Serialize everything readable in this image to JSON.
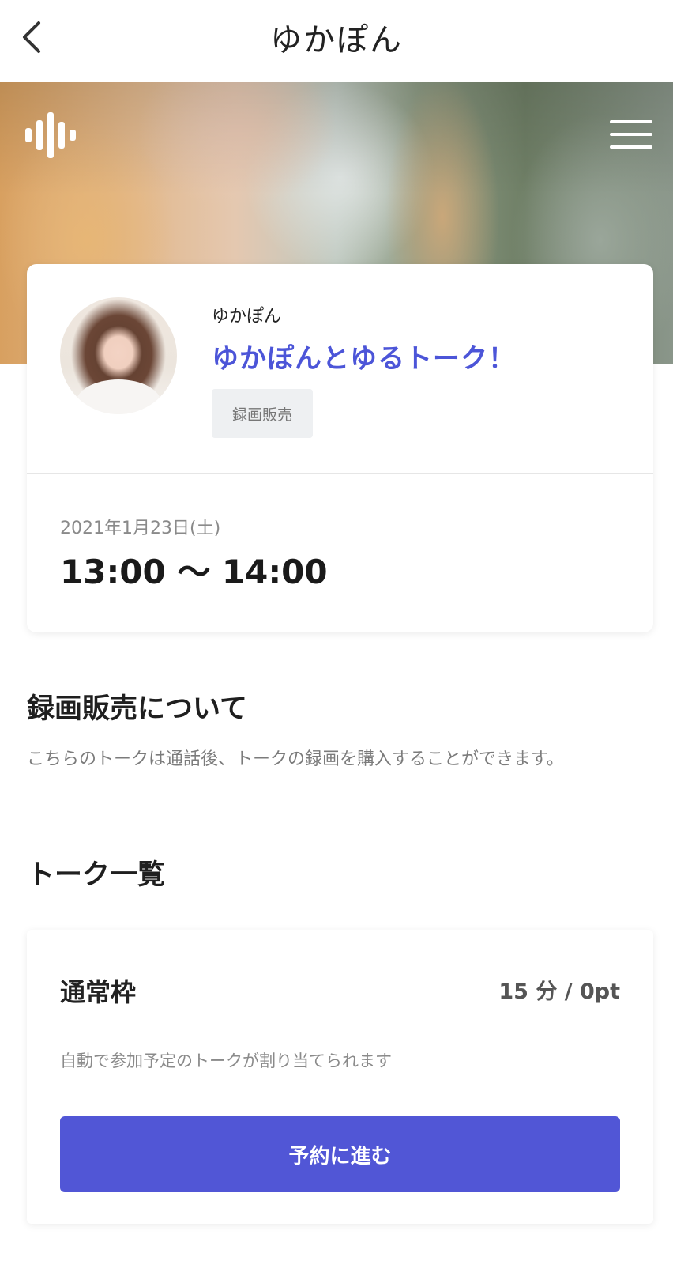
{
  "header": {
    "title": "ゆかぽん",
    "back_icon": "chevron-left-icon"
  },
  "hero": {
    "logo_icon": "waveform-logo-icon",
    "menu_icon": "hamburger-menu-icon"
  },
  "talk": {
    "host_name": "ゆかぽん",
    "title": "ゆかぽんとゆるトーク！",
    "badge": "録画販売",
    "date": "2021年1月23日(土)",
    "time_range": "13:00 〜 14:00",
    "accent_color": "#4c55d8"
  },
  "recording_section": {
    "title": "録画販売について",
    "description": "こちらのトークは通話後、トークの録画を購入することができます。"
  },
  "talk_list_section": {
    "title": "トーク一覧"
  },
  "plans": [
    {
      "name": "通常枠",
      "meta": "15 分 / 0pt",
      "description": "自動で参加予定のトークが割り当てられます",
      "button_label": "予約に進む",
      "button_color": "#5156d6"
    }
  ]
}
